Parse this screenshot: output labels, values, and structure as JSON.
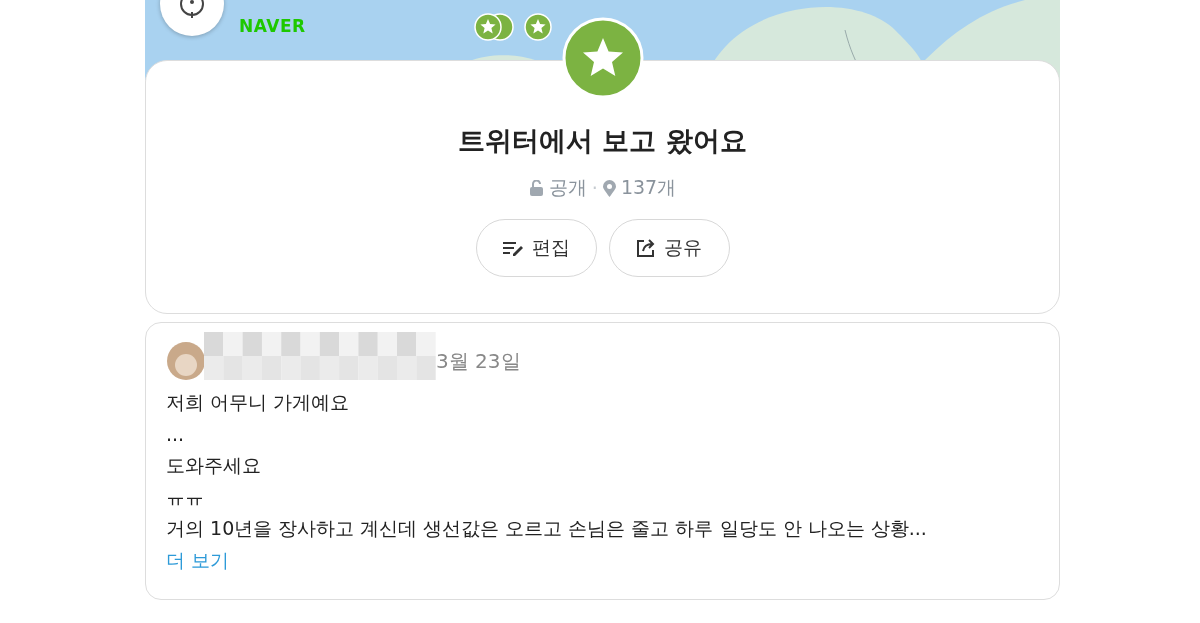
{
  "map": {
    "logo": "NAVER"
  },
  "list_card": {
    "title": "트위터에서 보고 왔어요",
    "visibility": "공개",
    "separator": "·",
    "place_count": "137개",
    "buttons": [
      {
        "kind": "edit",
        "label": "편집"
      },
      {
        "kind": "share",
        "label": "공유"
      }
    ]
  },
  "post": {
    "date": "3월 23일",
    "lines": [
      "저희 어무니 가게예요",
      "...",
      "도와주세요",
      "ㅠㅠ",
      "거의 10년을 장사하고 계신데 생선값은 오르고 손님은 줄고 하루 일당도 안 나오는 상황..."
    ],
    "more_link": "더 보기"
  }
}
